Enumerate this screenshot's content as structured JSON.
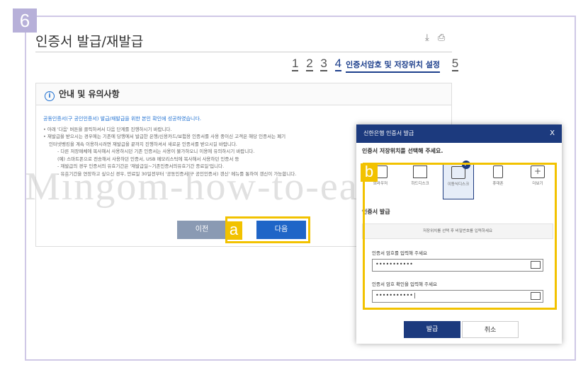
{
  "step_badge": "6",
  "page": {
    "title": "인증서 발급/재발급",
    "top_icons": [
      "download-icon",
      "print-icon"
    ],
    "steps": [
      "1",
      "2",
      "3",
      "4"
    ],
    "current_step_label": "인증서암호 및 저장위치 설정",
    "last_step": "5"
  },
  "notice": {
    "heading": "안내 및 유의사항",
    "lead": "공동인증서(구 공인인증서) 발급/재발급을 위한 본인 확인에 성공하였습니다.",
    "lines": [
      "• 아래 '다음' 버튼을 클릭하셔서 다음 단계를 진행하시기 바랍니다.",
      "• 재발급을 받으시는 경우에는 기존에 당행에서 발급한 은행/신용카드/보험용 인증서를 사용 중이신 고객은 해당 인증서는 폐기",
      "   인터넷뱅킹을 계속 이용하시려면 재발급을 끝까지 진행하셔서 새로운 인증서를 받으시길 바랍니다."
    ],
    "sub_lines": [
      "- 다른 저장매체에 복사해서 사용하시던 기존 인증서는 사용이 불가하오니 이용에 유의하시기 바랍니다.",
      "(예) 스마트폰으로 전송해서 사용하던 인증서, USB 메모리스틱에 복사해서 사용하던 인증서 등",
      "- 재발급의 경우 인증서의 유효기간은 '재발급일~기존인증서의유효기간 종료일'입니다.",
      "- 유효기간을 연장하고 싶으신 경우, 만료일 30일전부터 '공동인증서(구 공인인증서) 갱신' 메뉴를 통하여 갱신이 가능합니다."
    ]
  },
  "buttons": {
    "prev": "이전",
    "next": "다음"
  },
  "labels": {
    "a": "a",
    "b": "b"
  },
  "watermark": "Mingom-how-to-earn.com",
  "dialog": {
    "title": "신한은행 인증서 발급",
    "close": "X",
    "subtitle": "인증서 저장위치를 선택해 주세요.",
    "storage": [
      {
        "label": "브라우저",
        "icon": "browser-icon"
      },
      {
        "label": "하드디스크",
        "icon": "monitor-icon"
      },
      {
        "label": "이동식디스크",
        "icon": "usb-drive-icon",
        "selected": true
      },
      {
        "label": "휴대폰",
        "icon": "phone-icon"
      },
      {
        "label": "더보기",
        "icon": "more-icon"
      }
    ],
    "cert_label": "인증서 발급",
    "hint": "저장위치를 선택 후 비밀번호를 입력하세요",
    "pw_label": "인증서 암호를 입력해 주세요",
    "pw_value": "•••••••••••",
    "pw_confirm_label": "인증서 암호 확인을 입력해 주세요",
    "pw_confirm_value": "•••••••••••|",
    "issue": "발급",
    "cancel": "취소"
  }
}
